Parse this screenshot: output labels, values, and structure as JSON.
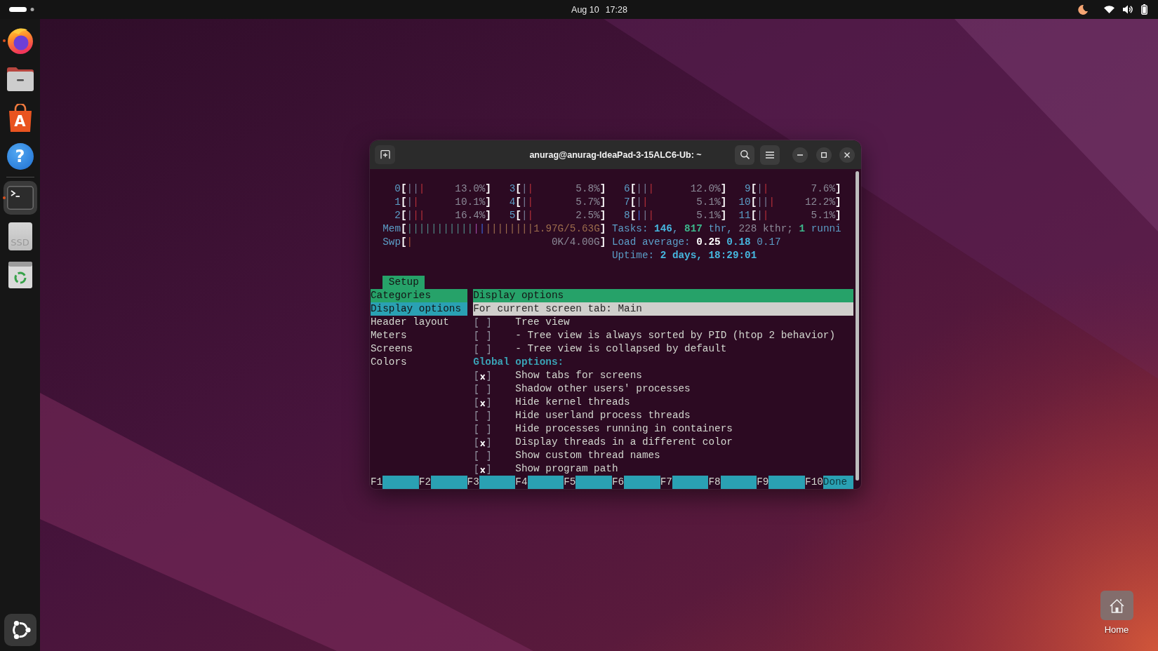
{
  "top_bar": {
    "date": "Aug 10",
    "time": "17:28"
  },
  "dock": {
    "favorites": [
      {
        "kind": "browser",
        "running": true,
        "selected": false
      },
      {
        "kind": "files",
        "running": false,
        "selected": false
      },
      {
        "kind": "store",
        "glyph": "A",
        "running": false,
        "selected": false
      },
      {
        "kind": "help",
        "glyph": "?",
        "running": false,
        "selected": false
      }
    ],
    "others": [
      {
        "kind": "terminal",
        "running": true,
        "selected": true
      },
      {
        "kind": "drive",
        "glyph": "SSD",
        "running": false,
        "selected": false
      },
      {
        "kind": "trash",
        "running": false,
        "selected": false
      }
    ]
  },
  "terminal": {
    "title": "anurag@anurag-IdeaPad-3-15ALC6-Ub: ~",
    "header": {
      "columns": [
        {
          "cpu_groups": [
            [
              {
                "caption": "0",
                "open": "[",
                "bar": [
                  {
                    "kind": "normal",
                    "text": "||"
                  },
                  {
                    "kind": "kernel",
                    "text": "|"
                  }
                ],
                "value": {
                  "kind": "shadow",
                  "text": "13.0%"
                },
                "close": "]"
              },
              {
                "caption": "1",
                "open": "[",
                "bar": [
                  {
                    "kind": "normal",
                    "text": "|"
                  },
                  {
                    "kind": "kernel",
                    "text": "|"
                  }
                ],
                "value": {
                  "kind": "shadow",
                  "text": "10.1%"
                },
                "close": "]"
              },
              {
                "caption": "2",
                "open": "[",
                "bar": [
                  {
                    "kind": "normal",
                    "text": "|"
                  },
                  {
                    "kind": "kernel",
                    "text": "||"
                  }
                ],
                "value": {
                  "kind": "shadow",
                  "text": "16.4%"
                },
                "close": "]"
              }
            ],
            [
              {
                "caption": "3",
                "open": "[",
                "bar": [
                  {
                    "kind": "normal",
                    "text": "|"
                  },
                  {
                    "kind": "kernel",
                    "text": "|"
                  }
                ],
                "value": {
                  "kind": "shadow",
                  "text": "5.8%"
                },
                "close": "]"
              },
              {
                "caption": "4",
                "open": "[",
                "bar": [
                  {
                    "kind": "normal",
                    "text": "|"
                  },
                  {
                    "kind": "kernel",
                    "text": "|"
                  }
                ],
                "value": {
                  "kind": "shadow",
                  "text": "5.7%"
                },
                "close": "]"
              },
              {
                "caption": "5",
                "open": "[",
                "bar": [
                  {
                    "kind": "normal",
                    "text": "|"
                  },
                  {
                    "kind": "kernel",
                    "text": "|"
                  }
                ],
                "value": {
                  "kind": "shadow",
                  "text": "2.5%"
                },
                "close": "]"
              }
            ]
          ],
          "meters": [
            {
              "kind": "bar",
              "caption": "Mem",
              "open": "[",
              "bar": [
                {
                  "kind": "used",
                  "text": "|||||||||||"
                },
                {
                  "kind": "shared",
                  "text": "|"
                },
                {
                  "kind": "buffers",
                  "text": "|"
                },
                {
                  "kind": "cache",
                  "text": "||||||||"
                }
              ],
              "value": {
                "kind": "cache",
                "text": "1.97G/5.63G"
              },
              "close": "]"
            },
            {
              "kind": "bar",
              "caption": "Swp",
              "open": "[",
              "bar": [
                {
                  "kind": "swap",
                  "text": "|"
                }
              ],
              "value": {
                "kind": "shadow",
                "text": "0K/4.00G"
              },
              "close": "]"
            }
          ]
        },
        {
          "cpu_groups": [
            [
              {
                "caption": "6",
                "open": "[",
                "bar": [
                  {
                    "kind": "normal",
                    "text": "||"
                  },
                  {
                    "kind": "kernel",
                    "text": "|"
                  }
                ],
                "value": {
                  "kind": "shadow",
                  "text": "12.0%"
                },
                "close": "]"
              },
              {
                "caption": "7",
                "open": "[",
                "bar": [
                  {
                    "kind": "normal",
                    "text": "|"
                  },
                  {
                    "kind": "kernel",
                    "text": "|"
                  }
                ],
                "value": {
                  "kind": "shadow",
                  "text": "5.1%"
                },
                "close": "]"
              },
              {
                "caption": "8",
                "open": "[",
                "bar": [
                  {
                    "kind": "low",
                    "text": "|"
                  },
                  {
                    "kind": "normal",
                    "text": "|"
                  },
                  {
                    "kind": "kernel",
                    "text": "|"
                  }
                ],
                "value": {
                  "kind": "shadow",
                  "text": "5.1%"
                },
                "close": "]"
              }
            ],
            [
              {
                "caption": "9",
                "open": "[",
                "bar": [
                  {
                    "kind": "normal",
                    "text": "|"
                  },
                  {
                    "kind": "kernel",
                    "text": "|"
                  }
                ],
                "value": {
                  "kind": "shadow",
                  "text": "7.6%"
                },
                "close": "]"
              },
              {
                "caption": "10",
                "open": "[",
                "bar": [
                  {
                    "kind": "normal",
                    "text": "||"
                  },
                  {
                    "kind": "kernel",
                    "text": "|"
                  }
                ],
                "value": {
                  "kind": "shadow",
                  "text": "12.2%"
                },
                "close": "]"
              },
              {
                "caption": "11",
                "open": "[",
                "bar": [
                  {
                    "kind": "normal",
                    "text": "|"
                  },
                  {
                    "kind": "kernel",
                    "text": "|"
                  }
                ],
                "value": {
                  "kind": "shadow",
                  "text": "5.1%"
                },
                "close": "]"
              }
            ]
          ],
          "meters": [
            {
              "kind": "text",
              "segments": [
                {
                  "kind": "label",
                  "text": "Tasks: "
                },
                {
                  "kind": "value",
                  "text": "146"
                },
                {
                  "kind": "label",
                  "text": ", "
                },
                {
                  "kind": "running",
                  "text": "817"
                },
                {
                  "kind": "label",
                  "text": " thr, "
                },
                {
                  "kind": "shadow",
                  "text": "228 kthr; "
                },
                {
                  "kind": "running",
                  "text": "1"
                },
                {
                  "kind": "label",
                  "text": " runni"
                }
              ]
            },
            {
              "kind": "text",
              "segments": [
                {
                  "kind": "label",
                  "text": "Load average: "
                },
                {
                  "kind": "bright",
                  "text": "0.25"
                },
                {
                  "kind": "value",
                  "text": " 0.18"
                },
                {
                  "kind": "label",
                  "text": " 0.17"
                }
              ]
            },
            {
              "kind": "text",
              "segments": [
                {
                  "kind": "label",
                  "text": "Uptime: "
                },
                {
                  "kind": "value",
                  "text": "2 days, 18:29:01"
                }
              ]
            }
          ]
        }
      ]
    },
    "tabs": [
      {
        "label": "Setup",
        "selected": true
      }
    ],
    "categories": {
      "title": "Categories",
      "items": [
        {
          "label": "Display options",
          "selected": true
        },
        {
          "label": "Header layout",
          "selected": false
        },
        {
          "label": "Meters",
          "selected": false
        },
        {
          "label": "Screens",
          "selected": false
        },
        {
          "label": "Colors",
          "selected": false
        }
      ]
    },
    "options": {
      "title": "Display options",
      "rows": [
        {
          "kind": "heading",
          "text": "For current screen tab: Main",
          "selected": true
        },
        {
          "kind": "option",
          "text": "Tree view",
          "checked": false,
          "selected": false
        },
        {
          "kind": "option",
          "text": "- Tree view is always sorted by PID (htop 2 behavior)",
          "checked": false,
          "selected": false
        },
        {
          "kind": "option",
          "text": "- Tree view is collapsed by default",
          "checked": false,
          "selected": false
        },
        {
          "kind": "heading",
          "text": "Global options:",
          "selected": false
        },
        {
          "kind": "option",
          "text": "Show tabs for screens",
          "checked": true,
          "selected": false
        },
        {
          "kind": "option",
          "text": "Shadow other users' processes",
          "checked": false,
          "selected": false
        },
        {
          "kind": "option",
          "text": "Hide kernel threads",
          "checked": true,
          "selected": false
        },
        {
          "kind": "option",
          "text": "Hide userland process threads",
          "checked": false,
          "selected": false
        },
        {
          "kind": "option",
          "text": "Hide processes running in containers",
          "checked": false,
          "selected": false
        },
        {
          "kind": "option",
          "text": "Display threads in a different color",
          "checked": true,
          "selected": false
        },
        {
          "kind": "option",
          "text": "Show custom thread names",
          "checked": false,
          "selected": false
        },
        {
          "kind": "option",
          "text": "Show program path",
          "checked": true,
          "selected": false
        }
      ]
    },
    "function_keys": [
      {
        "key": "F1"
      },
      {
        "key": "F2"
      },
      {
        "key": "F3"
      },
      {
        "key": "F4"
      },
      {
        "key": "F5"
      },
      {
        "key": "F6"
      },
      {
        "key": "F7"
      },
      {
        "key": "F8"
      },
      {
        "key": "F9"
      },
      {
        "key": "F10",
        "label": "Done"
      }
    ]
  },
  "desktop_icons": [
    {
      "label": "Home"
    }
  ]
}
